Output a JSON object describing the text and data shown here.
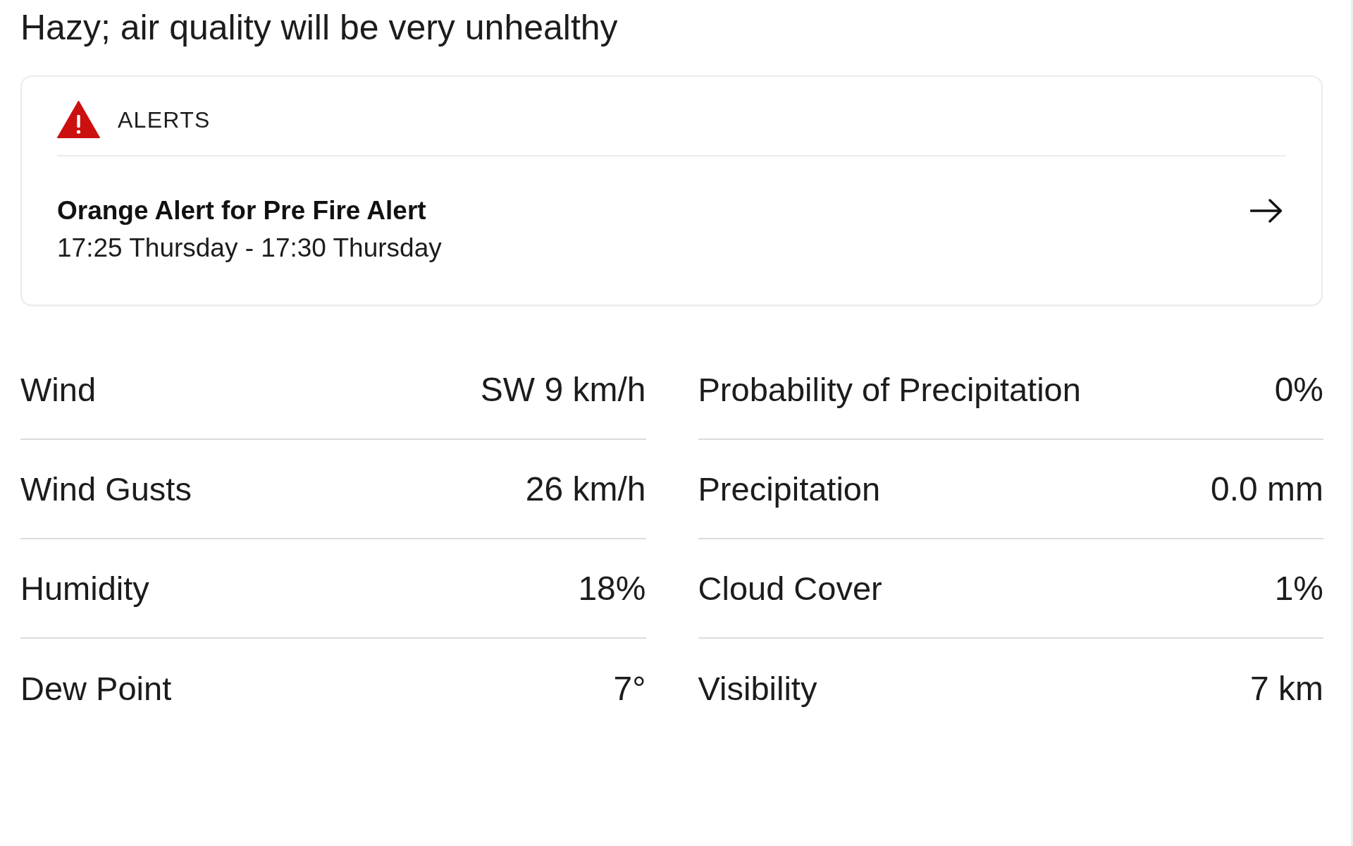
{
  "headline": "Hazy; air quality will be very unhealthy",
  "alerts_card": {
    "heading": "ALERTS",
    "alerts": [
      {
        "title": "Orange Alert for Pre Fire Alert",
        "time_range": "17:25 Thursday - 17:30 Thursday"
      }
    ]
  },
  "details": {
    "columns": [
      {
        "rows": [
          {
            "label": "Wind",
            "value": "SW 9 km/h"
          },
          {
            "label": "Wind Gusts",
            "value": "26 km/h"
          },
          {
            "label": "Humidity",
            "value": "18%"
          },
          {
            "label": "Dew Point",
            "value": "7°"
          }
        ]
      },
      {
        "rows": [
          {
            "label": "Probability of Precipitation",
            "value": "0%"
          },
          {
            "label": "Precipitation",
            "value": "0.0 mm"
          },
          {
            "label": "Cloud Cover",
            "value": "1%"
          },
          {
            "label": "Visibility",
            "value": "7 km"
          }
        ]
      }
    ]
  }
}
